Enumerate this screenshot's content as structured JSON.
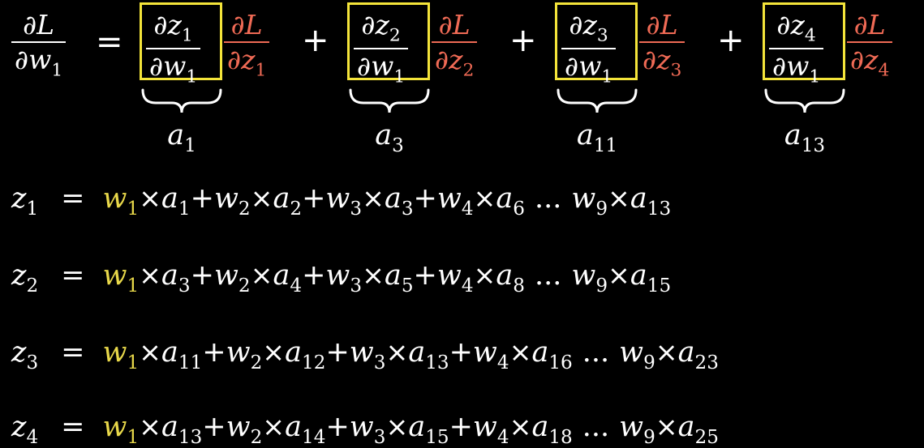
{
  "top_equation": {
    "lhs": {
      "num_sym": "∂L",
      "den_sym": "∂w",
      "den_sub": "1"
    },
    "equals": "=",
    "plus": "+",
    "terms": [
      {
        "num": "∂z",
        "num_sub": "1",
        "den": "∂w",
        "den_sub": "1",
        "red_num": "∂L",
        "red_den": "∂z",
        "red_sub": "1",
        "brace_var": "a",
        "brace_sub": "1"
      },
      {
        "num": "∂z",
        "num_sub": "2",
        "den": "∂w",
        "den_sub": "1",
        "red_num": "∂L",
        "red_den": "∂z",
        "red_sub": "2",
        "brace_var": "a",
        "brace_sub": "3"
      },
      {
        "num": "∂z",
        "num_sub": "3",
        "den": "∂w",
        "den_sub": "1",
        "red_num": "∂L",
        "red_den": "∂z",
        "red_sub": "3",
        "brace_var": "a",
        "brace_sub": "11"
      },
      {
        "num": "∂z",
        "num_sub": "4",
        "den": "∂w",
        "den_sub": "1",
        "red_num": "∂L",
        "red_den": "∂z",
        "red_sub": "4",
        "brace_var": "a",
        "brace_sub": "13"
      }
    ]
  },
  "rows": [
    {
      "lhs_sub": "1",
      "a": [
        "1",
        "2",
        "3",
        "6"
      ],
      "last_a": "13"
    },
    {
      "lhs_sub": "2",
      "a": [
        "3",
        "4",
        "5",
        "8"
      ],
      "last_a": "15"
    },
    {
      "lhs_sub": "3",
      "a": [
        "11",
        "12",
        "13",
        "16"
      ],
      "last_a": "23"
    },
    {
      "lhs_sub": "4",
      "a": [
        "13",
        "14",
        "15",
        "18"
      ],
      "last_a": "25"
    }
  ],
  "row_text": {
    "z": "z",
    "w": "w",
    "a": "a",
    "eq": "=",
    "times": "×",
    "plus": "+",
    "dots": "...",
    "w_last_sub": "9"
  },
  "colors": {
    "background": "#000000",
    "text": "#ffffff",
    "highlight_box": "#f4e43a",
    "red_term": "#ef6a55",
    "w1": "#e8d84a"
  }
}
